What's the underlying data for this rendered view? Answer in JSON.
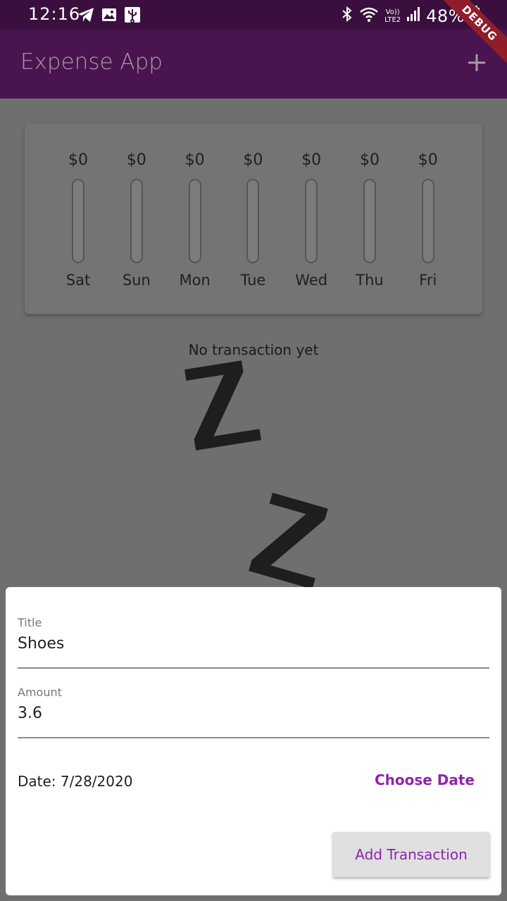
{
  "status_bar": {
    "time": "12:16",
    "network_label_top": "Vo))",
    "network_label_bottom": "LTE2",
    "battery_percent": "48%"
  },
  "debug_banner": "DEBUG",
  "app_bar": {
    "title": "Expense App",
    "add_icon": "plus-icon"
  },
  "chart": {
    "days": [
      {
        "day": "Sat",
        "amount": "$0",
        "fill_fraction": 0
      },
      {
        "day": "Sun",
        "amount": "$0",
        "fill_fraction": 0
      },
      {
        "day": "Mon",
        "amount": "$0",
        "fill_fraction": 0
      },
      {
        "day": "Tue",
        "amount": "$0",
        "fill_fraction": 0
      },
      {
        "day": "Wed",
        "amount": "$0",
        "fill_fraction": 0
      },
      {
        "day": "Thu",
        "amount": "$0",
        "fill_fraction": 0
      },
      {
        "day": "Fri",
        "amount": "$0",
        "fill_fraction": 0
      }
    ]
  },
  "transactions": {
    "empty_message": "No transaction yet",
    "empty_image": "zzz-sleep-image"
  },
  "form": {
    "title_label": "Title",
    "title_value": "Shoes",
    "amount_label": "Amount",
    "amount_value": "3.6",
    "date_text": "Date: 7/28/2020",
    "choose_date_label": "Choose Date",
    "submit_label": "Add Transaction"
  },
  "colors": {
    "primary": "#4a1450",
    "accent": "#8e24aa",
    "status_bar": "#3a0f3e",
    "scrim_background": "#6f6f6f"
  }
}
